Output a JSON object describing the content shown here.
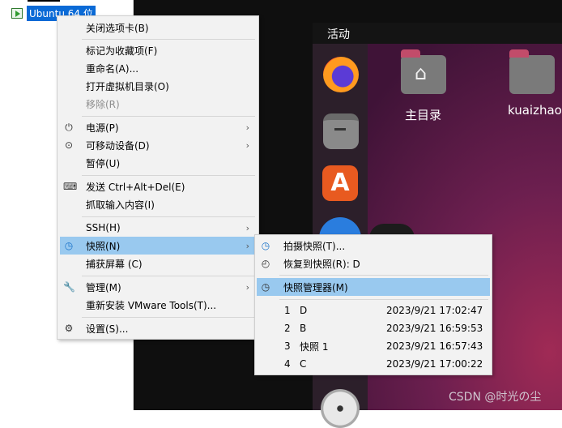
{
  "library": {
    "vm_name": "Ubuntu 64 位"
  },
  "guest": {
    "activities": "活动",
    "desktop_items": [
      {
        "label": "主目录"
      },
      {
        "label": "kuaizhao"
      }
    ],
    "dock_icons": [
      "firefox-icon",
      "files-icon",
      "app-store-icon",
      "help-icon",
      "disc-icon"
    ],
    "watermark": "CSDN @时光の尘"
  },
  "context_menu": {
    "items": [
      {
        "label": "关闭选项卡(B)",
        "icon": "",
        "enabled": true
      },
      {
        "label": "标记为收藏项(F)",
        "icon": "",
        "enabled": true
      },
      {
        "label": "重命名(A)...",
        "icon": "",
        "enabled": true
      },
      {
        "label": "打开虚拟机目录(O)",
        "icon": "",
        "enabled": true
      },
      {
        "label": "移除(R)",
        "icon": "",
        "enabled": false
      },
      {
        "label": "电源(P)",
        "icon": "power-icon",
        "enabled": true,
        "submenu": true
      },
      {
        "label": "可移动设备(D)",
        "icon": "removable-device-icon",
        "enabled": true,
        "submenu": true
      },
      {
        "label": "暂停(U)",
        "icon": "",
        "enabled": true
      },
      {
        "label": "发送 Ctrl+Alt+Del(E)",
        "icon": "keyboard-icon",
        "enabled": true
      },
      {
        "label": "抓取输入内容(I)",
        "icon": "",
        "enabled": true
      },
      {
        "label": "SSH(H)",
        "icon": "",
        "enabled": true,
        "submenu": true
      },
      {
        "label": "快照(N)",
        "icon": "snapshot-icon",
        "enabled": true,
        "submenu": true,
        "highlighted": true
      },
      {
        "label": "捕获屏幕 (C)",
        "icon": "",
        "enabled": true
      },
      {
        "label": "管理(M)",
        "icon": "wrench-icon",
        "enabled": true,
        "submenu": true
      },
      {
        "label": "重新安装 VMware Tools(T)...",
        "icon": "",
        "enabled": true
      },
      {
        "label": "设置(S)...",
        "icon": "settings-icon",
        "enabled": true
      }
    ]
  },
  "snapshot_menu": {
    "take": "拍摄快照(T)...",
    "revert": "恢复到快照(R): D",
    "manager": "快照管理器(M)",
    "snapshots": [
      {
        "num": "1",
        "name": "D",
        "date": "2023/9/21 17:02:47"
      },
      {
        "num": "2",
        "name": "B",
        "date": "2023/9/21 16:59:53"
      },
      {
        "num": "3",
        "name": "快照 1",
        "date": "2023/9/21 16:57:43"
      },
      {
        "num": "4",
        "name": "C",
        "date": "2023/9/21 17:00:22"
      }
    ]
  },
  "colors": {
    "highlight": "#99c9ef",
    "menu_bg": "#f2f2f2",
    "selection": "#0a6ad6"
  }
}
